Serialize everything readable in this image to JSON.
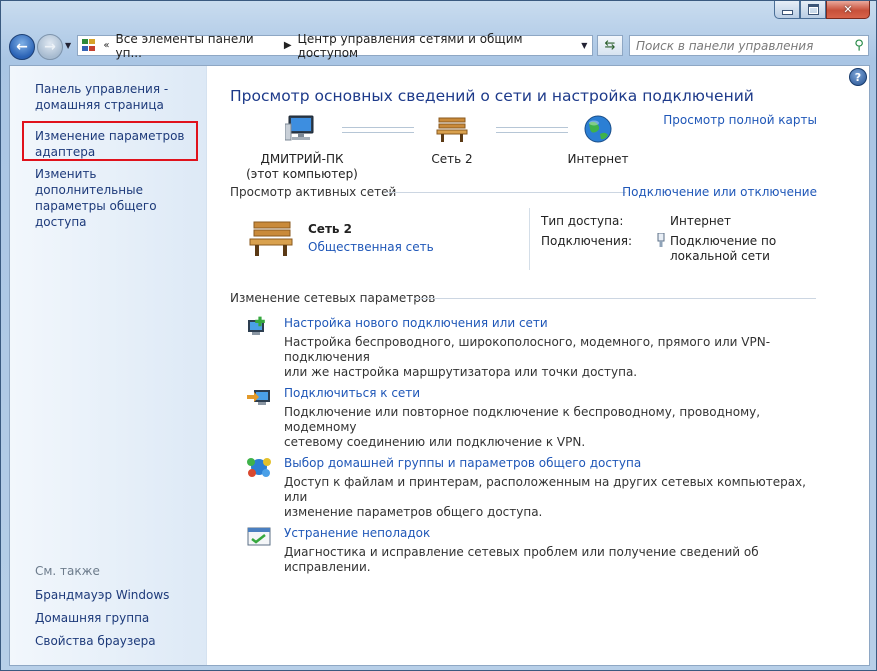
{
  "window": {
    "controls": {
      "minimize": "",
      "maximize": "",
      "close": "✕"
    }
  },
  "nav": {
    "breadcrumbs": [
      "Все элементы панели уп...",
      "Центр управления сетями и общим доступом"
    ],
    "search_placeholder": "Поиск в панели управления"
  },
  "sidebar": {
    "items": [
      {
        "label_1": "Панель управления -",
        "label_2": "домашняя страница"
      },
      {
        "label_1": "Изменение параметров",
        "label_2": "адаптера"
      },
      {
        "label_1": "Изменить дополнительные",
        "label_2": "параметры общего доступа"
      }
    ],
    "see_also_title": "См. также",
    "see_also": [
      "Брандмауэр Windows",
      "Домашняя группа",
      "Свойства браузера"
    ]
  },
  "main": {
    "title": "Просмотр основных сведений о сети и настройка подключений",
    "full_map_link": "Просмотр полной карты",
    "map": {
      "computer_name": "ДМИТРИЙ-ПК",
      "computer_sub": "(этот компьютер)",
      "network": "Сеть  2",
      "internet": "Интернет"
    },
    "active_networks": {
      "heading": "Просмотр активных сетей",
      "connect_link": "Подключение или отключение",
      "network_name": "Сеть  2",
      "network_type": "Общественная сеть",
      "access_label": "Тип доступа:",
      "access_value": "Интернет",
      "connections_label": "Подключения:",
      "connection_value_1": "Подключение по",
      "connection_value_2": "локальной сети"
    },
    "change_settings": {
      "heading": "Изменение сетевых параметров",
      "tasks": [
        {
          "title": "Настройка нового подключения или сети",
          "desc_1": "Настройка беспроводного, широкополосного, модемного, прямого или VPN-подключения",
          "desc_2": "или же настройка маршрутизатора или точки доступа."
        },
        {
          "title": "Подключиться к сети",
          "desc_1": "Подключение или повторное подключение к беспроводному, проводному, модемному",
          "desc_2": "сетевому соединению или подключение к VPN."
        },
        {
          "title": "Выбор домашней группы и параметров общего доступа",
          "desc_1": "Доступ к файлам и принтерам, расположенным на других сетевых компьютерах, или",
          "desc_2": "изменение параметров общего доступа."
        },
        {
          "title": "Устранение неполадок",
          "desc_1": "Диагностика и исправление сетевых проблем или получение сведений об исправлении.",
          "desc_2": ""
        }
      ]
    }
  },
  "colors": {
    "link": "#1f57b8",
    "title": "#1d3a8a",
    "highlight_box": "#e0121c"
  }
}
